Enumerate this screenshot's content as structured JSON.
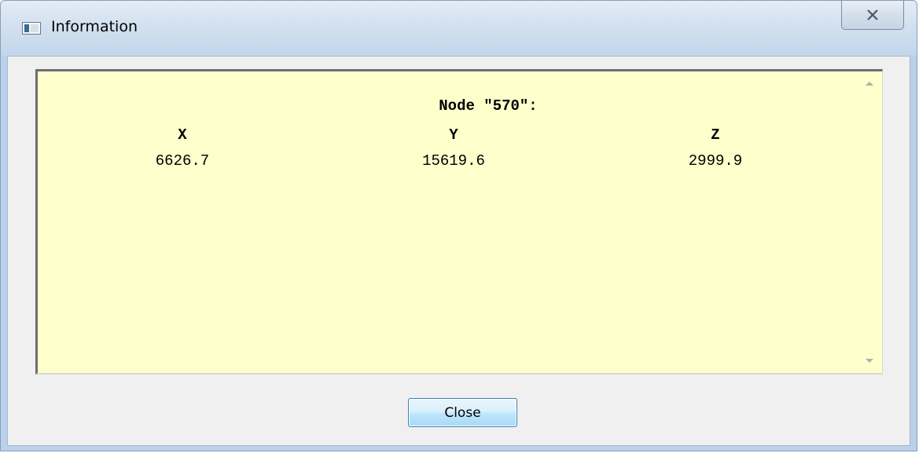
{
  "window": {
    "title": "Information",
    "icons": {
      "app": "application-window-icon",
      "close": "close-x-icon"
    }
  },
  "info": {
    "node_title": "Node \"570\":",
    "columns": [
      {
        "header": "X",
        "value": "6626.7"
      },
      {
        "header": "Y",
        "value": "15619.6"
      },
      {
        "header": "Z",
        "value": "2999.9"
      }
    ]
  },
  "buttons": {
    "close_label": "Close"
  },
  "colors": {
    "panel_background": "#ffffcc",
    "dialog_background": "#f0f0f0",
    "button_border": "#3c7fb1"
  }
}
